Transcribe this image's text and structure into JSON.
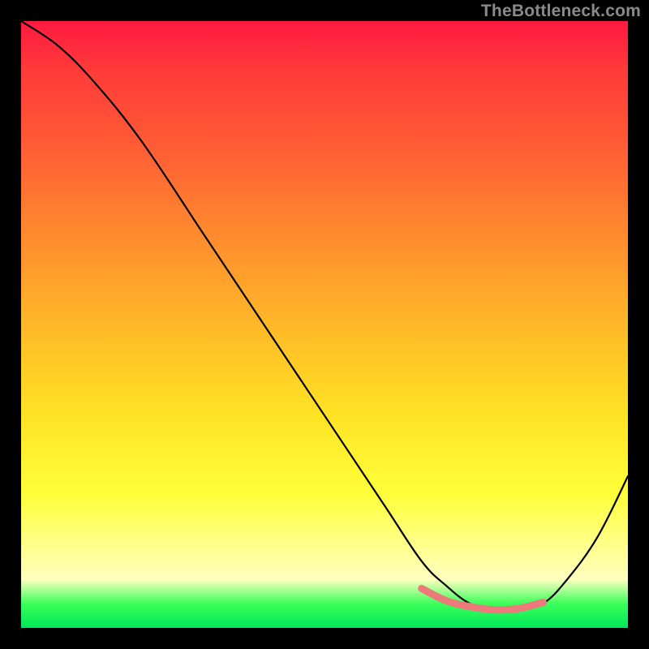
{
  "watermark": "TheBottleneck.com",
  "chart_data": {
    "type": "line",
    "title": "",
    "xlabel": "",
    "ylabel": "",
    "xlim": [
      0,
      100
    ],
    "ylim": [
      0,
      100
    ],
    "grid": false,
    "background_gradient": [
      "#ff1a40",
      "#ff8a2e",
      "#ffe324",
      "#ffff88",
      "#00e85a"
    ],
    "series": [
      {
        "name": "black-curve",
        "color": "#000000",
        "x": [
          0,
          6,
          12,
          20,
          30,
          40,
          50,
          60,
          66,
          70,
          74,
          78,
          82,
          86,
          90,
          95,
          100
        ],
        "y": [
          100,
          96,
          90,
          80,
          65,
          50,
          35,
          20,
          11,
          7,
          4,
          3,
          3,
          4,
          8,
          15,
          25
        ]
      },
      {
        "name": "pink-trough",
        "color": "#ed7a7a",
        "x": [
          66,
          70,
          74,
          78,
          82,
          86
        ],
        "y": [
          6.5,
          4.5,
          3.5,
          3,
          3.2,
          4.2
        ]
      }
    ]
  }
}
